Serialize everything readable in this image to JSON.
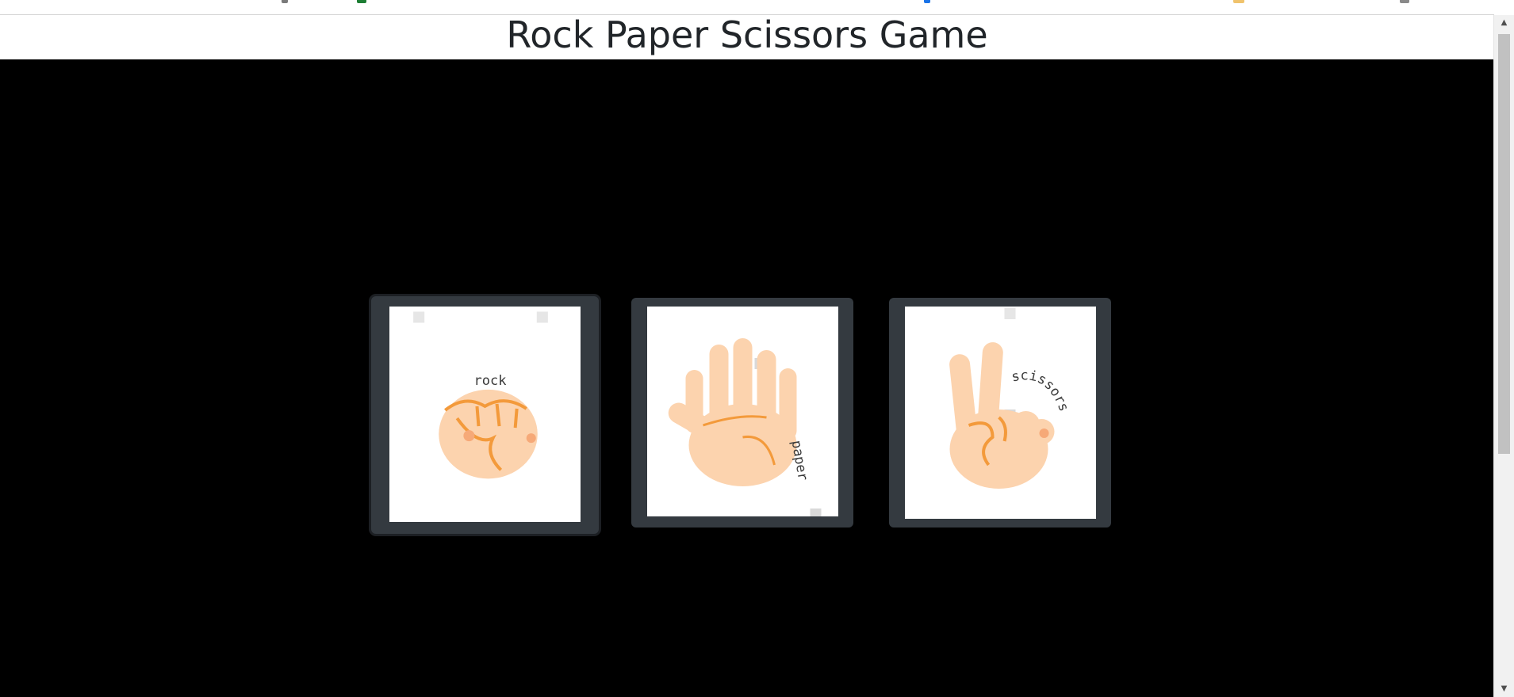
{
  "page": {
    "title": "Rock Paper Scissors Game"
  },
  "choices": [
    {
      "id": "rock",
      "label": "rock",
      "selected": true
    },
    {
      "id": "paper",
      "label": "paper",
      "selected": false
    },
    {
      "id": "scissors",
      "label": "scissors",
      "selected": false
    }
  ],
  "colors": {
    "arena_background": "#000000",
    "card_frame": "#343a40",
    "title_text": "#212529",
    "skin": "#fcd3ae",
    "skin_line": "#f39a3b"
  },
  "scrollbar": {
    "up_icon": "chevron-up-icon",
    "down_icon": "chevron-down-icon"
  }
}
